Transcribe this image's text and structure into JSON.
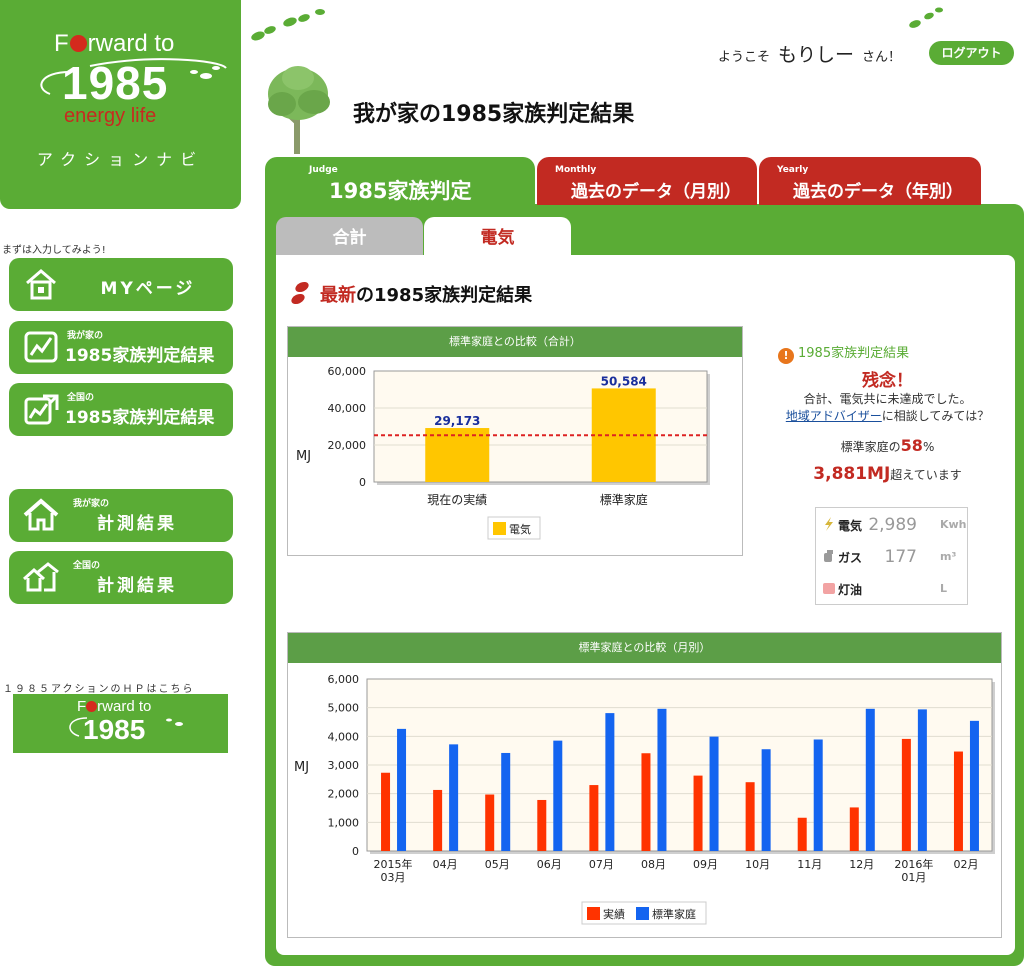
{
  "brand": {
    "logo_line1": "Forward to",
    "logo_year": "1985",
    "logo_sub": "energy life",
    "logo_navi": "アクションナビ"
  },
  "sidebar": {
    "hint": "まずは入力してみよう!",
    "items": [
      {
        "label": "MYページ",
        "icon": "home-icon"
      },
      {
        "small": "我が家の",
        "label": "1985家族判定結果",
        "icon": "chart-icon"
      },
      {
        "small": "全国の",
        "label": "1985家族判定結果",
        "icon": "chart-up-icon"
      },
      {
        "small": "我が家の",
        "label": "計測結果",
        "icon": "house-icon"
      },
      {
        "small": "全国の",
        "label": "計測結果",
        "icon": "houses-icon"
      }
    ],
    "hp_hint": "１９８５アクションのＨＰはこちら",
    "banner_line1": "Forward to",
    "banner_year": "1985"
  },
  "header": {
    "welcome_prefix": "ようこそ",
    "user_name": "もりしー",
    "welcome_suffix": "さん！",
    "logout_label": "ログアウト",
    "page_title": "我が家の1985家族判定結果"
  },
  "tabs": [
    {
      "en": "Judge",
      "label": "1985家族判定"
    },
    {
      "en": "Monthly",
      "label": "過去のデータ（月別）"
    },
    {
      "en": "Yearly",
      "label": "過去のデータ（年別）"
    }
  ],
  "subtabs": [
    "合計",
    "電気"
  ],
  "section": {
    "title_hl": "最新",
    "title_rest": "の1985家族判定結果"
  },
  "result": {
    "title": "1985家族判定結果",
    "main": "残念！",
    "text": "合計、電気共に未達成でした。",
    "advice_link": "地域アドバイザー",
    "advice_rest": "に相談してみては？",
    "pct_prefix": "標準家庭の",
    "pct_value": "58",
    "pct_suffix": "%",
    "excess_value": "3,881MJ",
    "excess_suffix": "超えています",
    "usage": [
      {
        "label": "電気",
        "value": "2,989",
        "unit": "Kwh",
        "icon": "lightning-icon"
      },
      {
        "label": "ガス",
        "value": "177",
        "unit": "m³",
        "icon": "gas-icon"
      },
      {
        "label": "灯油",
        "value": "",
        "unit": "L",
        "icon": "kerosene-icon"
      }
    ]
  },
  "colors": {
    "green": "#5aac35",
    "red": "#c22a22",
    "bar_yellow": "#ffc600",
    "bar_red": "#ff3300",
    "bar_blue": "#1464f0"
  },
  "chart_data": [
    {
      "type": "bar",
      "title": "標準家庭との比較（合計）",
      "ylabel": "MJ",
      "categories": [
        "現在の実績",
        "標準家庭"
      ],
      "series": [
        {
          "name": "電気",
          "values": [
            29173,
            50584
          ]
        }
      ],
      "value_labels": [
        "29,173",
        "50,584"
      ],
      "ylim": [
        0,
        60000
      ],
      "yticks": [
        "0",
        "20,000",
        "40,000",
        "60,000"
      ],
      "reference_line": 25300,
      "grid": true,
      "legend": "bottom"
    },
    {
      "type": "bar",
      "title": "標準家庭との比較（月別）",
      "ylabel": "MJ",
      "categories": [
        "2015年\n03月",
        "04月",
        "05月",
        "06月",
        "07月",
        "08月",
        "09月",
        "10月",
        "11月",
        "12月",
        "2016年\n01月",
        "02月"
      ],
      "series": [
        {
          "name": "実績",
          "values": [
            2730,
            2130,
            1970,
            1780,
            2300,
            3410,
            2630,
            2400,
            1160,
            1520,
            3910,
            3470
          ]
        },
        {
          "name": "標準家庭",
          "values": [
            4260,
            3720,
            3420,
            3850,
            4810,
            4960,
            3990,
            3550,
            3890,
            4960,
            4940,
            4540
          ]
        }
      ],
      "ylim": [
        0,
        6000
      ],
      "yticks": [
        "0",
        "1,000",
        "2,000",
        "3,000",
        "4,000",
        "5,000",
        "6,000"
      ],
      "grid": true,
      "legend": "bottom"
    }
  ]
}
